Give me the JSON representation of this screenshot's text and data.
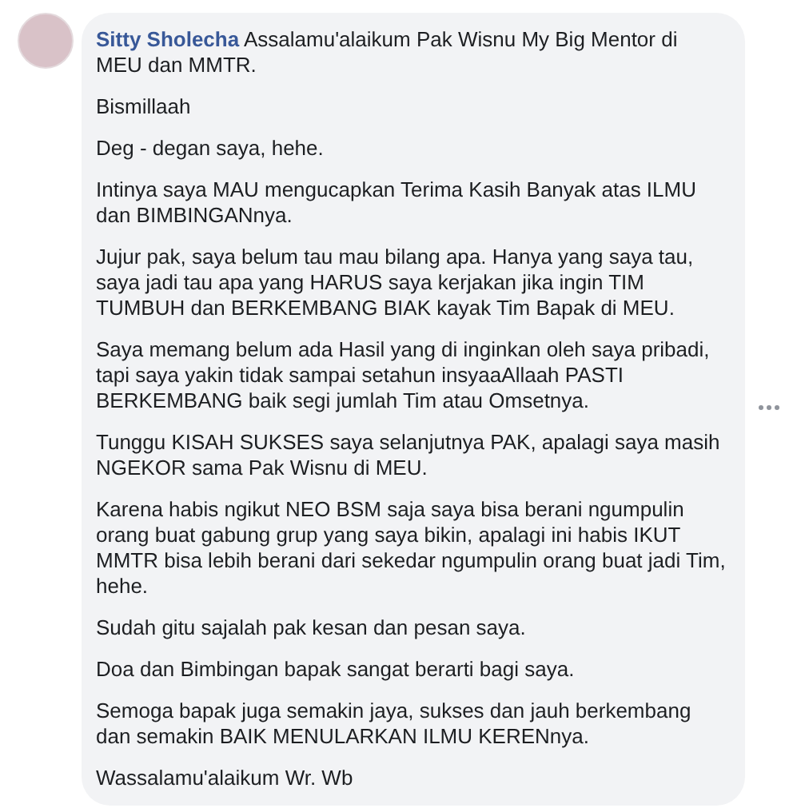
{
  "comment": {
    "author": "Sitty Sholecha",
    "paragraphs": [
      "Assalamu'alaikum Pak Wisnu My Big Mentor di MEU dan MMTR.",
      "Bismillaah",
      "Deg - degan saya, hehe.",
      "Intinya saya MAU mengucapkan Terima Kasih Banyak atas ILMU dan BIMBINGANnya.",
      "Jujur pak, saya belum tau mau bilang apa. Hanya yang saya tau, saya jadi tau apa yang HARUS saya kerjakan jika ingin TIM TUMBUH dan BERKEMBANG BIAK kayak Tim Bapak di MEU.",
      "Saya memang belum ada Hasil yang di inginkan oleh saya pribadi, tapi saya yakin tidak sampai setahun insyaaAllaah PASTI BERKEMBANG baik segi jumlah Tim atau Omsetnya.",
      "Tunggu KISAH SUKSES saya selanjutnya PAK, apalagi saya masih NGEKOR sama Pak Wisnu di MEU.",
      "Karena habis ngikut NEO BSM saja saya bisa berani ngumpulin orang buat gabung grup yang saya bikin, apalagi ini habis IKUT MMTR bisa lebih berani dari sekedar ngumpulin orang buat jadi Tim, hehe.",
      "Sudah gitu sajalah pak kesan dan pesan saya.",
      "Doa dan Bimbingan bapak sangat berarti bagi saya.",
      "Semoga bapak juga semakin jaya, sukses dan jauh berkembang dan semakin BAIK MENULARKAN ILMU KERENnya.",
      "Wassalamu'alaikum Wr. Wb"
    ]
  }
}
